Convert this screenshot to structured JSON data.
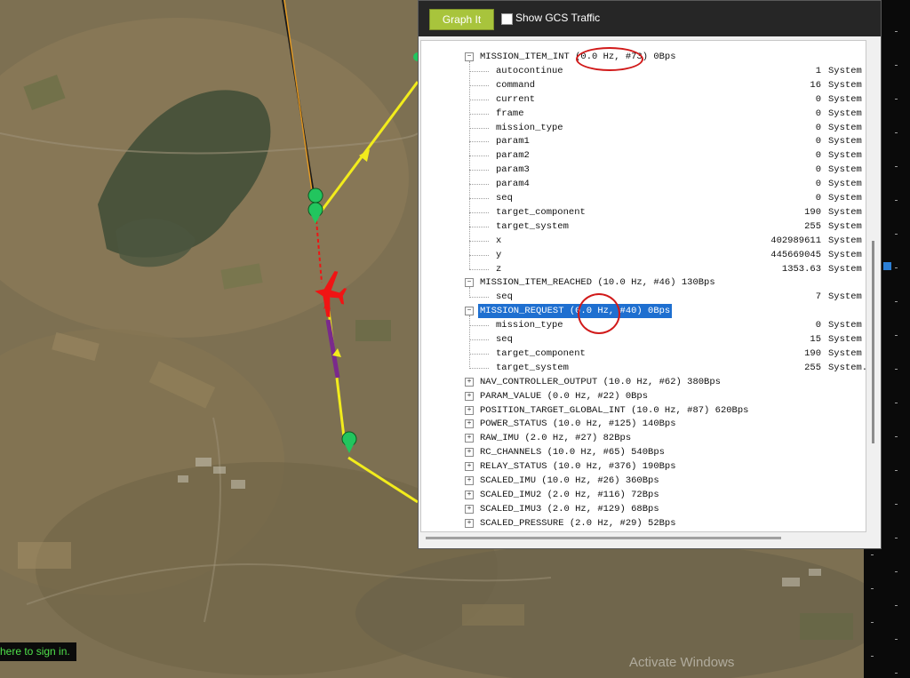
{
  "toolbar": {
    "graph_button": "Graph It",
    "show_gcs_label": "Show GCS Traffic",
    "show_gcs_checked": false
  },
  "inspector": {
    "groups_top": [
      {
        "label": "MISSION_ITEM_INT (0.0 Hz, #73) 0Bps",
        "expanded": true,
        "fields": [
          {
            "name": "autocontinue",
            "value": "1",
            "unit": "System"
          },
          {
            "name": "command",
            "value": "16",
            "unit": "System"
          },
          {
            "name": "current",
            "value": "0",
            "unit": "System"
          },
          {
            "name": "frame",
            "value": "0",
            "unit": "System"
          },
          {
            "name": "mission_type",
            "value": "0",
            "unit": "System"
          },
          {
            "name": "param1",
            "value": "0",
            "unit": "System"
          },
          {
            "name": "param2",
            "value": "0",
            "unit": "System"
          },
          {
            "name": "param3",
            "value": "0",
            "unit": "System"
          },
          {
            "name": "param4",
            "value": "0",
            "unit": "System"
          },
          {
            "name": "seq",
            "value": "0",
            "unit": "System"
          },
          {
            "name": "target_component",
            "value": "190",
            "unit": "System"
          },
          {
            "name": "target_system",
            "value": "255",
            "unit": "System"
          },
          {
            "name": "x",
            "value": "402989611",
            "unit": "System"
          },
          {
            "name": "y",
            "value": "445669045",
            "unit": "System"
          },
          {
            "name": "z",
            "value": "1353.63",
            "unit": "System"
          }
        ]
      },
      {
        "label": "MISSION_ITEM_REACHED (10.0 Hz, #46) 130Bps",
        "expanded": true,
        "fields": [
          {
            "name": "seq",
            "value": "7",
            "unit": "System"
          }
        ]
      },
      {
        "label": "MISSION_REQUEST (0.0 Hz, #40) 0Bps",
        "expanded": true,
        "selected": true,
        "fields": [
          {
            "name": "mission_type",
            "value": "0",
            "unit": "System"
          },
          {
            "name": "seq",
            "value": "15",
            "unit": "System"
          },
          {
            "name": "target_component",
            "value": "190",
            "unit": "System"
          },
          {
            "name": "target_system",
            "value": "255",
            "unit": "System.Byte"
          }
        ]
      }
    ],
    "groups_collapsed": [
      "NAV_CONTROLLER_OUTPUT (10.0 Hz, #62) 380Bps",
      "PARAM_VALUE (0.0 Hz, #22) 0Bps",
      "POSITION_TARGET_GLOBAL_INT (10.0 Hz, #87) 620Bps",
      "POWER_STATUS (10.0 Hz, #125) 140Bps",
      "RAW_IMU (2.0 Hz, #27) 82Bps",
      "RC_CHANNELS (10.0 Hz, #65) 540Bps",
      "RELAY_STATUS (10.0 Hz, #376) 190Bps",
      "SCALED_IMU (10.0 Hz, #26) 360Bps",
      "SCALED_IMU2 (2.0 Hz, #116) 72Bps",
      "SCALED_IMU3 (2.0 Hz, #129) 68Bps",
      "SCALED_PRESSURE (2.0 Hz, #29) 52Bps"
    ]
  },
  "map": {
    "sign_in_text": "here to sign in.",
    "watermark": "Activate Windows"
  },
  "colors": {
    "accent_button": "#a8c43c",
    "route": "#f2ec1c",
    "aircraft": "#f01414",
    "annotation": "#d11a1a",
    "selection": "#1e6fd0"
  }
}
